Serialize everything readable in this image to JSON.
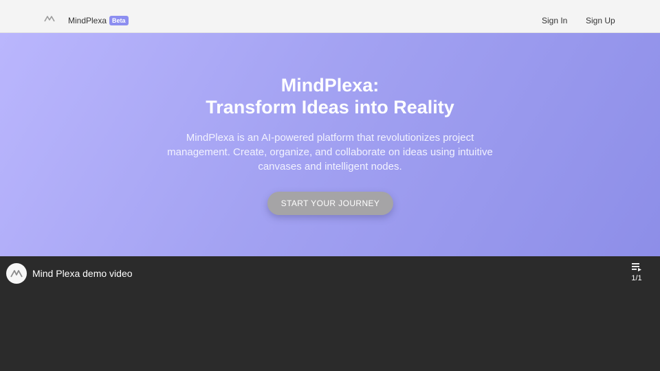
{
  "header": {
    "brand": "MindPlexa",
    "badge": "Beta",
    "sign_in": "Sign In",
    "sign_up": "Sign Up",
    "logo_icon": "mindplexa-logo-icon"
  },
  "hero": {
    "title_line1": "MindPlexa:",
    "title_line2": "Transform Ideas into Reality",
    "description": "MindPlexa is an AI-powered platform that revolutionizes project management. Create, organize, and collaborate on ideas using intuitive canvases and intelligent nodes.",
    "cta": "START YOUR JOURNEY"
  },
  "video": {
    "title": "Mind Plexa demo video",
    "playlist_count": "1/1",
    "playlist_icon": "playlist-icon",
    "channel_icon": "mindplexa-logo-icon"
  },
  "colors": {
    "hero_gradient_start": "#bab6fd",
    "hero_gradient_end": "#8d8ee8",
    "badge": "#8c8ef0",
    "cta_bg": "#a5a4a6",
    "video_bg": "#2b2b2b"
  }
}
